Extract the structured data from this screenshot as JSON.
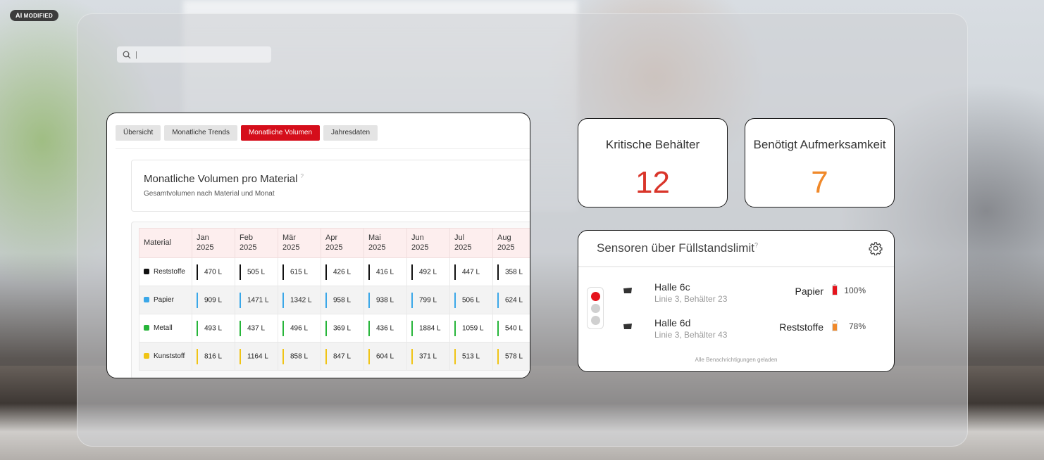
{
  "badge": {
    "ai": "AI",
    "text": "MODIFIED"
  },
  "search": {
    "value": "",
    "placeholder": "|"
  },
  "tabs": [
    {
      "label": "Übersicht",
      "active": false
    },
    {
      "label": "Monatliche Trends",
      "active": false
    },
    {
      "label": "Monatliche Volumen",
      "active": true
    },
    {
      "label": "Jahresdaten",
      "active": false
    }
  ],
  "volumes": {
    "title": "Monatliche Volumen pro Material",
    "info": "?",
    "subtitle": "Gesamtvolumen nach Material und Monat",
    "header_material": "Material",
    "months": [
      [
        "Jan",
        "2025"
      ],
      [
        "Feb",
        "2025"
      ],
      [
        "Mär",
        "2025"
      ],
      [
        "Apr",
        "2025"
      ],
      [
        "Mai",
        "2025"
      ],
      [
        "Jun",
        "2025"
      ],
      [
        "Jul",
        "2025"
      ],
      [
        "Aug",
        "2025"
      ]
    ],
    "rows": [
      {
        "material": "Reststoffe",
        "color": "#111111",
        "values": [
          "470 L",
          "505 L",
          "615 L",
          "426 L",
          "416 L",
          "492 L",
          "447 L",
          "358 L"
        ]
      },
      {
        "material": "Papier",
        "color": "#3aa7e8",
        "values": [
          "909 L",
          "1471 L",
          "1342 L",
          "958 L",
          "938 L",
          "799 L",
          "506 L",
          "624 L"
        ]
      },
      {
        "material": "Metall",
        "color": "#27b53a",
        "values": [
          "493 L",
          "437 L",
          "496 L",
          "369 L",
          "436 L",
          "1884 L",
          "1059 L",
          "540 L"
        ]
      },
      {
        "material": "Kunststoff",
        "color": "#f0c415",
        "values": [
          "816 L",
          "1164 L",
          "858 L",
          "847 L",
          "604 L",
          "371 L",
          "513 L",
          "578 L"
        ]
      }
    ]
  },
  "kpis": [
    {
      "label": "Kritische Behälter",
      "value": "12",
      "color": "#d9352a"
    },
    {
      "label": "Benötigt Aufmerksamkeit",
      "value": "7",
      "color": "#f0892a"
    }
  ],
  "sensors": {
    "title": "Sensoren über Füllstandslimit",
    "info": "?",
    "items": [
      {
        "hall": "Halle 6c",
        "location": "Linie 3, Behälter 23",
        "material": "Papier",
        "fill": "100%",
        "fill_fraction": 1.0,
        "battery_color": "#e5141c"
      },
      {
        "hall": "Halle 6d",
        "location": "Linie 3, Behälter 43",
        "material": "Reststoffe",
        "fill": "78%",
        "fill_fraction": 0.78,
        "battery_color": "#f0892a"
      }
    ],
    "footer": "Alle Benachrichtigungen geladen"
  },
  "colors": {
    "accent": "#d50e1b"
  }
}
